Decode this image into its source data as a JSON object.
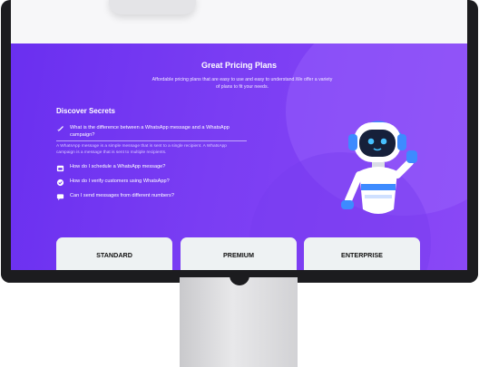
{
  "pricing": {
    "title": "Great Pricing Plans",
    "subtitle": "Affordable pricing plans that are easy to use and easy to understand.We offer a variety of plans to fit your needs."
  },
  "faq": {
    "heading": "Discover Secrets",
    "items": [
      {
        "icon": "rocket-icon",
        "question": "What is the difference between a WhatsApp message and a WhatsApp campaign?",
        "answer": "A WhatsApp message is a simple message that is sent to a single recipient. A WhatsApp campaign is a message that is sent to multiple recipients."
      },
      {
        "icon": "calendar-icon",
        "question": "How do I schedule a WhatsApp message?"
      },
      {
        "icon": "verified-icon",
        "question": "How do I verify customers using WhatsApp?"
      },
      {
        "icon": "chat-icon",
        "question": "Can I send messages from different numbers?"
      }
    ]
  },
  "plans": [
    "STANDARD",
    "PREMIUM",
    "ENTERPRISE"
  ],
  "colors": {
    "hero_start": "#6a2ff0",
    "hero_end": "#8a48f6",
    "robot_accent": "#3d8bff",
    "card_bg": "#eef2f3"
  }
}
